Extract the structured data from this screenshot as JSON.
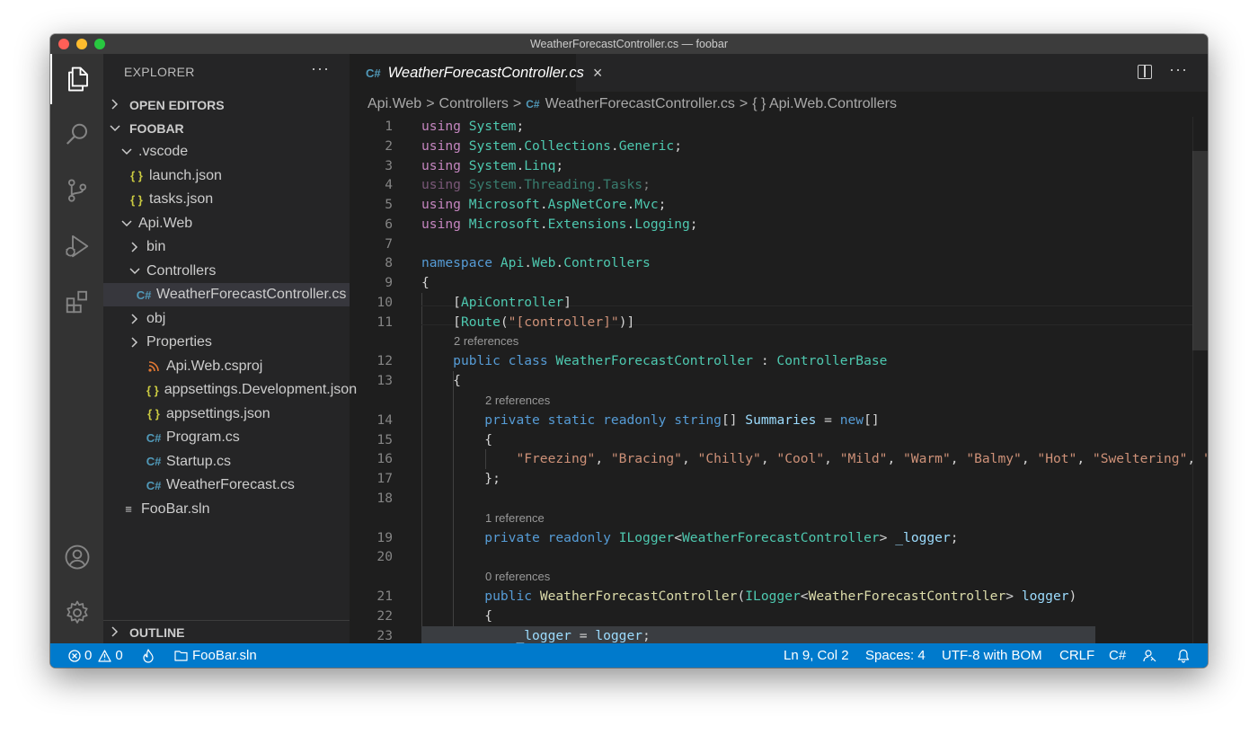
{
  "window": {
    "title": "WeatherForecastController.cs — foobar"
  },
  "activity_bar": {
    "items": [
      "explorer-icon",
      "search-icon",
      "source-control-icon",
      "run-debug-icon",
      "extensions-icon"
    ],
    "bottom": [
      "accounts-icon",
      "manage-gear-icon"
    ]
  },
  "sidebar": {
    "header": "EXPLORER",
    "more": "···",
    "open_editors": "OPEN EDITORS",
    "root": "FOOBAR",
    "outline": "OUTLINE",
    "tree": [
      {
        "label": ".vscode",
        "chevron": "down",
        "icon": ""
      },
      {
        "label": "launch.json",
        "chevron": "",
        "icon": "{ }"
      },
      {
        "label": "tasks.json",
        "chevron": "",
        "icon": "{ }"
      },
      {
        "label": "Api.Web",
        "chevron": "down",
        "icon": ""
      },
      {
        "label": "bin",
        "chevron": "right",
        "icon": ""
      },
      {
        "label": "Controllers",
        "chevron": "down",
        "icon": ""
      },
      {
        "label": "WeatherForecastController.cs",
        "chevron": "",
        "icon": "C#",
        "selected": true
      },
      {
        "label": "obj",
        "chevron": "right",
        "icon": ""
      },
      {
        "label": "Properties",
        "chevron": "right",
        "icon": ""
      },
      {
        "label": "Api.Web.csproj",
        "chevron": "",
        "icon": "rss"
      },
      {
        "label": "appsettings.Development.json",
        "chevron": "",
        "icon": "{ }"
      },
      {
        "label": "appsettings.json",
        "chevron": "",
        "icon": "{ }"
      },
      {
        "label": "Program.cs",
        "chevron": "",
        "icon": "C#"
      },
      {
        "label": "Startup.cs",
        "chevron": "",
        "icon": "C#"
      },
      {
        "label": "WeatherForecast.cs",
        "chevron": "",
        "icon": "C#"
      },
      {
        "label": "FooBar.sln",
        "chevron": "",
        "icon": "≡"
      }
    ]
  },
  "tabs": [
    {
      "label": "WeatherForecastController.cs",
      "icon": "C#",
      "close": "×"
    }
  ],
  "editor_actions": {
    "more": "···"
  },
  "breadcrumb": [
    "Api.Web",
    "Controllers",
    "WeatherForecastController.cs",
    "{ } Api.Web.Controllers"
  ],
  "breadcrumb_file_icon": "C#",
  "breadcrumb_sep": ">",
  "code_lines": [
    {
      "n": "1",
      "text": "using System;"
    },
    {
      "n": "2",
      "text": "using System.Collections.Generic;"
    },
    {
      "n": "3",
      "text": "using System.Linq;"
    },
    {
      "n": "4",
      "text": "using System.Threading.Tasks;"
    },
    {
      "n": "5",
      "text": "using Microsoft.AspNetCore.Mvc;"
    },
    {
      "n": "6",
      "text": "using Microsoft.Extensions.Logging;"
    },
    {
      "n": "7",
      "text": ""
    },
    {
      "n": "8",
      "text": "namespace Api.Web.Controllers"
    },
    {
      "n": "9",
      "text": "{"
    },
    {
      "n": "10",
      "text": "    [ApiController]"
    },
    {
      "n": "11",
      "text": "    [Route(\"[controller]\")]"
    },
    {
      "n": "12",
      "text": "    public class WeatherForecastController : ControllerBase"
    },
    {
      "n": "13",
      "text": "    {"
    },
    {
      "n": "14",
      "text": "        private static readonly string[] Summaries = new[]"
    },
    {
      "n": "15",
      "text": "        {"
    },
    {
      "n": "16",
      "text": "            \"Freezing\", \"Bracing\", \"Chilly\", \"Cool\", \"Mild\", \"Warm\", \"Balmy\", \"Hot\", \"Sweltering\", \"S"
    },
    {
      "n": "17",
      "text": "        };"
    },
    {
      "n": "18",
      "text": ""
    },
    {
      "n": "19",
      "text": "        private readonly ILogger<WeatherForecastController> _logger;"
    },
    {
      "n": "20",
      "text": ""
    },
    {
      "n": "21",
      "text": "        public WeatherForecastController(ILogger<WeatherForecastController> logger)"
    },
    {
      "n": "22",
      "text": "        {"
    },
    {
      "n": "23",
      "text": "            _logger = logger;"
    }
  ],
  "codelens": [
    "2 references",
    "2 references",
    "1 reference",
    "0 references"
  ],
  "status_bar": {
    "errors": "0",
    "warnings": "0",
    "solution": "FooBar.sln",
    "position": "Ln 9, Col 2",
    "spaces": "Spaces: 4",
    "encoding": "UTF-8 with BOM",
    "eol": "CRLF",
    "language": "C#"
  },
  "colors": {
    "keyword_control": "#c586c0",
    "keyword": "#569cd6",
    "type": "#4ec9b0",
    "string": "#ce9178",
    "method": "#dcdcaa",
    "variable": "#9cdcfe",
    "status_bar": "#007acc"
  }
}
